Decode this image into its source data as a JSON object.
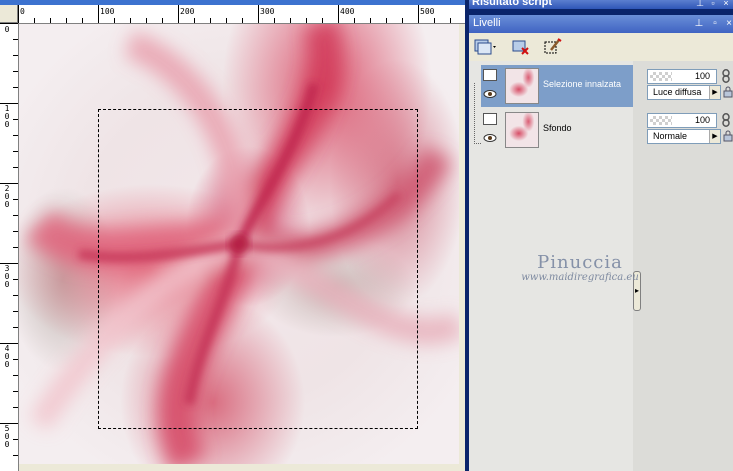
{
  "script_panel": {
    "title": "Risultato script"
  },
  "layers_panel": {
    "title": "Livelli",
    "layers": [
      {
        "name": "Selezione innalzata",
        "opacity": "100",
        "blend_mode": "Luce diffusa",
        "selected": true
      },
      {
        "name": "Sfondo",
        "opacity": "100",
        "blend_mode": "Normale",
        "selected": false
      }
    ]
  },
  "rulers": {
    "horizontal": [
      "0",
      "100",
      "200",
      "300",
      "400",
      "500"
    ],
    "vertical": [
      "0",
      "1 0 0",
      "2 0 0",
      "3 0 0",
      "4 0 0",
      "5 0 0"
    ]
  },
  "watermark": {
    "signature": "Pinuccia",
    "url": "www.maidiregrafica.eu"
  },
  "colors": {
    "selection_highlight": "#7d9ec9",
    "titlebar": "#3f63c2",
    "swirl_pink": "#d8405c"
  },
  "icons": [
    "new-layer-icon",
    "delete-layer-icon",
    "edit-selection-icon",
    "eye-icon",
    "link-icon",
    "lock-icon"
  ]
}
